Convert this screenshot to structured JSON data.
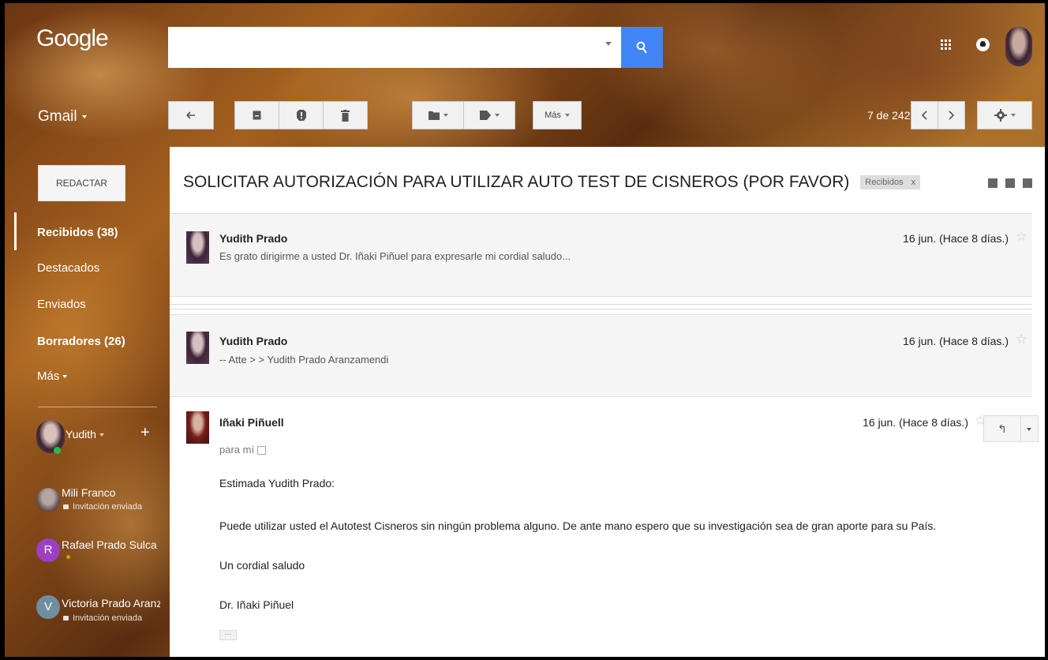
{
  "header": {
    "logo": "Google",
    "search_value": "",
    "apps_icon": "apps-grid-icon",
    "notifications_icon": "notifications-icon"
  },
  "app_label": "Gmail",
  "toolbar": {
    "back_icon": "back-arrow-icon",
    "archive_icon": "archive-icon",
    "spam_icon": "report-spam-icon",
    "delete_icon": "trash-icon",
    "move_icon": "folder-icon",
    "labels_icon": "label-icon",
    "more_label": "Más",
    "pager": "7 de 242",
    "settings_icon": "gear-icon"
  },
  "sidebar": {
    "compose_label": "REDACTAR",
    "items": [
      {
        "label": "Recibidos (38)",
        "bold": true
      },
      {
        "label": "Destacados",
        "bold": false
      },
      {
        "label": "Enviados",
        "bold": false
      },
      {
        "label": "Borradores (26)",
        "bold": true
      },
      {
        "label": "Más",
        "bold": false
      }
    ],
    "chat_user": "Yudith",
    "contacts": [
      {
        "name": "Mili Franco",
        "status": "Invitación enviada",
        "initial": ""
      },
      {
        "name": "Rafael Prado Sulca",
        "status": "",
        "initial": "R"
      },
      {
        "name": "Victoria Prado Aranz",
        "status": "Invitación enviada",
        "initial": "V"
      }
    ]
  },
  "thread": {
    "subject": "SOLICITAR AUTORIZACIÓN PARA UTILIZAR AUTO TEST DE CISNEROS (POR FAVOR)",
    "label": "Recibidos",
    "label_close": "x",
    "messages": [
      {
        "sender": "Yudith Prado",
        "snippet": "Es grato dirigirme a usted Dr. Iñaki Piñuel para expresarle mi cordial saludo...",
        "date": "16 jun. (Hace 8 días.)"
      },
      {
        "sender": "Yudith Prado",
        "snippet": "-- Atte > > Yudith Prado Aranzamendi",
        "date": "16 jun. (Hace 8 días.)"
      },
      {
        "sender": "Iñaki Piñuell",
        "to": "para mí",
        "date": "16 jun. (Hace 8 días.)",
        "body": [
          "Estimada Yudith Prado:",
          "Puede utilizar usted el Autotest Cisneros sin ningún problema alguno. De ante mano espero que su investigación sea de gran aporte para su País.",
          "Un cordial saludo",
          "Dr. Iñaki Piñuel"
        ],
        "show_trimmed": "···"
      }
    ]
  },
  "colors": {
    "search_button": "#4285f4",
    "online": "#2bb84a",
    "contact_r": "#9c3fc4",
    "contact_v": "#6f8ea0"
  }
}
